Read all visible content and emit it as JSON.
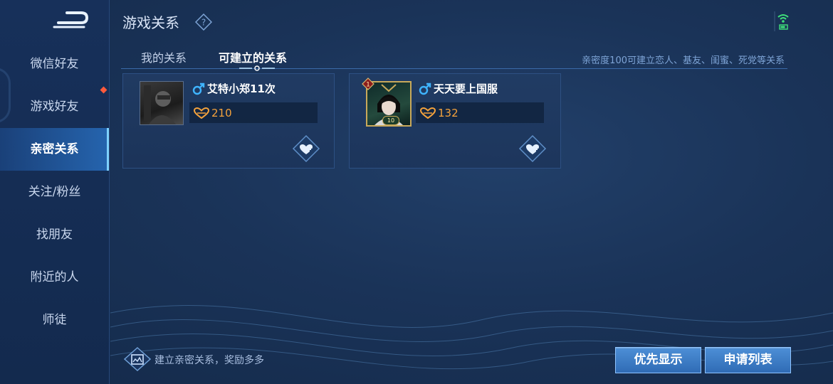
{
  "header": {
    "title": "游戏关系"
  },
  "tabs": [
    {
      "label": "我的关系",
      "active": false
    },
    {
      "label": "可建立的关系",
      "active": true
    }
  ],
  "hint": "亲密度100可建立恋人、基友、闺蜜、死党等关系",
  "sidebar": {
    "items": [
      {
        "label": "微信好友"
      },
      {
        "label": "游戏好友"
      },
      {
        "label": "亲密关系"
      },
      {
        "label": "关注/粉丝"
      },
      {
        "label": "找朋友"
      },
      {
        "label": "附近的人"
      },
      {
        "label": "师徒"
      }
    ],
    "active_index": 2
  },
  "cards": [
    {
      "name": "艾特小郑11次",
      "gender": "male",
      "intimacy": "210"
    },
    {
      "name": "天天要上国服",
      "gender": "male",
      "intimacy": "132",
      "rank_badge": "1",
      "avatar_level": "10"
    }
  ],
  "footer": {
    "reward_text": "建立亲密关系，奖励多多",
    "priority_button": "优先显示",
    "request_list_button": "申请列表"
  },
  "colors": {
    "accent": "#7fd2ff",
    "intimacy": "#f4a23c",
    "gender_male": "#3fb4ff",
    "red_dot": "#ff5a3c"
  },
  "icons": [
    "back-icon",
    "help-icon",
    "signal-icon",
    "male-icon",
    "heart-icon",
    "add-heart-icon",
    "gift-icon"
  ]
}
